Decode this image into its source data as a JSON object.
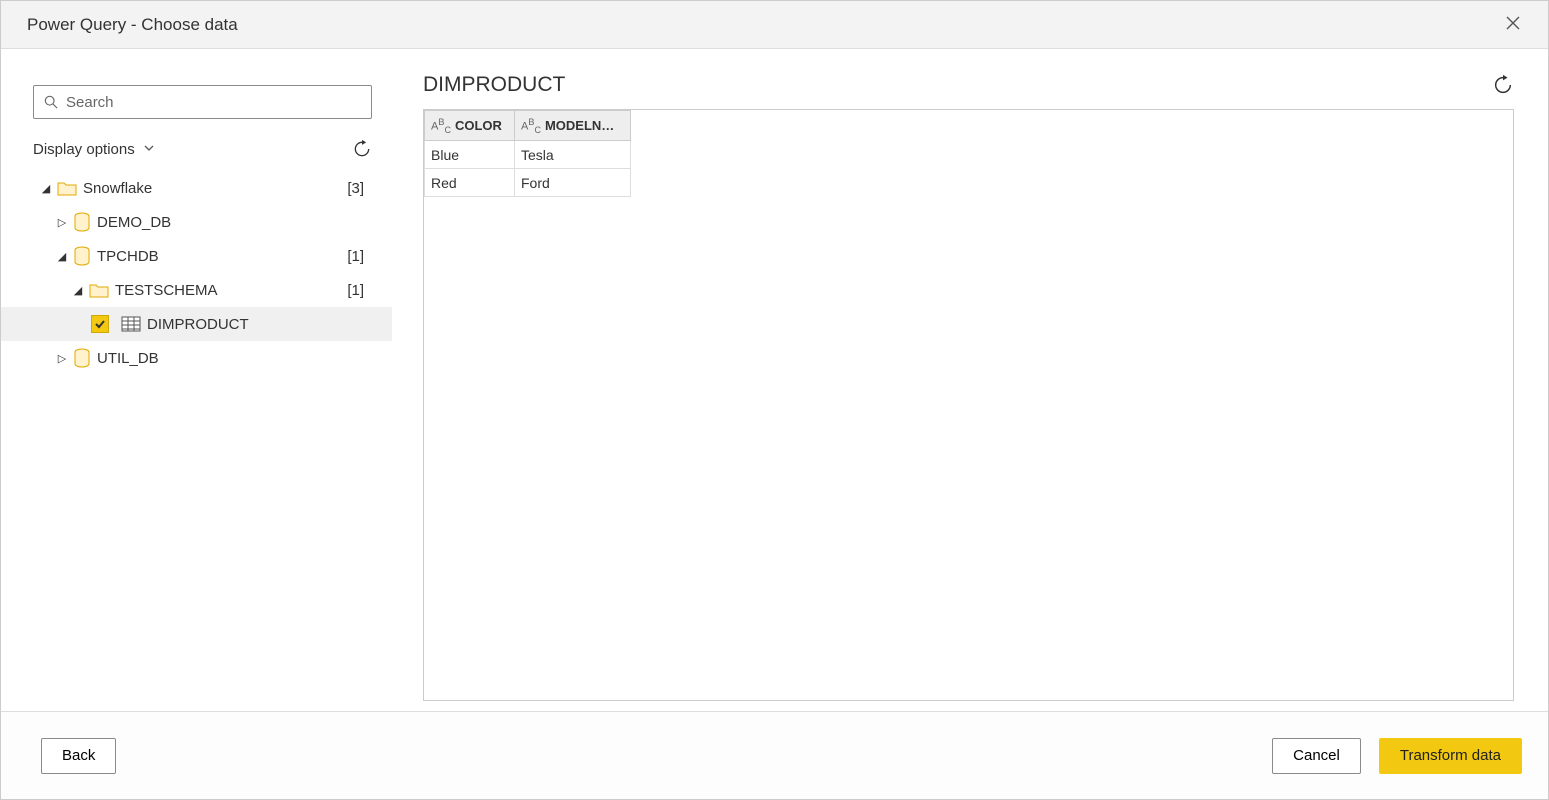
{
  "window": {
    "title": "Power Query - Choose data"
  },
  "search": {
    "placeholder": "Search"
  },
  "display_options": {
    "label": "Display options"
  },
  "tree": {
    "root": {
      "label": "Snowflake",
      "count": "[3]"
    },
    "demo_db": {
      "label": "DEMO_DB"
    },
    "tpchdb": {
      "label": "TPCHDB",
      "count": "[1]"
    },
    "testschema": {
      "label": "TESTSCHEMA",
      "count": "[1]"
    },
    "dimproduct": {
      "label": "DIMPRODUCT"
    },
    "util_db": {
      "label": "UTIL_DB"
    }
  },
  "preview": {
    "title": "DIMPRODUCT",
    "columns": {
      "color": "COLOR",
      "model": "MODELN…"
    },
    "rows": [
      {
        "color": "Blue",
        "model": "Tesla"
      },
      {
        "color": "Red",
        "model": "Ford"
      }
    ]
  },
  "footer": {
    "back": "Back",
    "cancel": "Cancel",
    "transform": "Transform data"
  }
}
